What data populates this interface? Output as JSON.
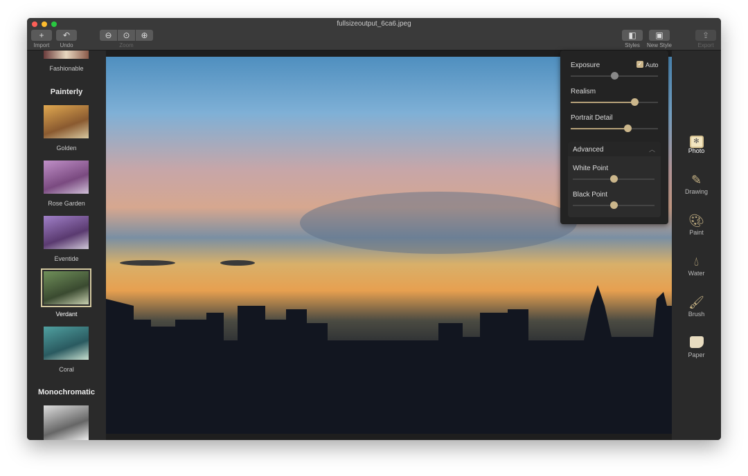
{
  "window": {
    "title": "fullsizeoutput_6ca6.jpeg"
  },
  "toolbar": {
    "import": "Import",
    "undo": "Undo",
    "zoom": "Zoom",
    "styles": "Styles",
    "new_style": "New Style",
    "export": "Export"
  },
  "sidebar": {
    "partial_item": "Fashionable",
    "sections": [
      {
        "title": "Painterly",
        "items": [
          {
            "label": "Golden"
          },
          {
            "label": "Rose Garden"
          },
          {
            "label": "Eventide"
          },
          {
            "label": "Verdant",
            "selected": true
          },
          {
            "label": "Coral"
          }
        ]
      },
      {
        "title": "Monochromatic",
        "items": []
      }
    ]
  },
  "panel": {
    "exposure": {
      "label": "Exposure",
      "value": 0.5,
      "auto_label": "Auto",
      "auto": true
    },
    "realism": {
      "label": "Realism",
      "value": 0.73
    },
    "portrait_detail": {
      "label": "Portrait Detail",
      "value": 0.65
    },
    "advanced": {
      "label": "Advanced",
      "expanded": true,
      "white_point": {
        "label": "White Point",
        "value": 0.5
      },
      "black_point": {
        "label": "Black Point",
        "value": 0.5
      }
    }
  },
  "tools": [
    {
      "label": "Photo",
      "icon": "photo-icon",
      "active": true
    },
    {
      "label": "Drawing",
      "icon": "pencil-icon"
    },
    {
      "label": "Paint",
      "icon": "palette-icon"
    },
    {
      "label": "Water",
      "icon": "drop-icon"
    },
    {
      "label": "Brush",
      "icon": "brush-icon"
    },
    {
      "label": "Paper",
      "icon": "paper-icon"
    }
  ],
  "colors": {
    "accent": "#cbb68b"
  }
}
